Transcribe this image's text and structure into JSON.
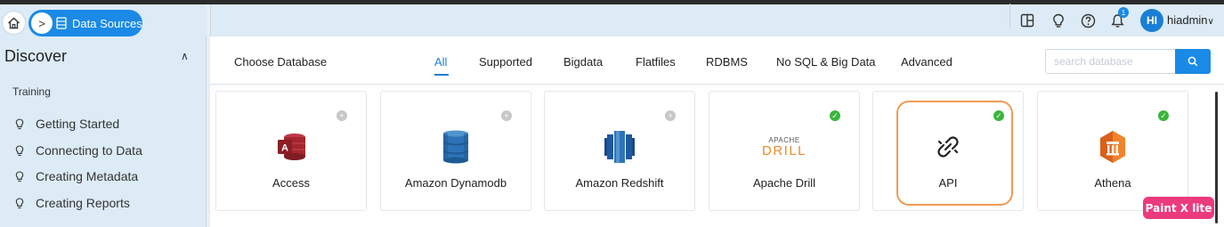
{
  "breadcrumb": {
    "current": "Data Sources",
    "separator": ">"
  },
  "header": {
    "notification_count": "1",
    "avatar_initials": "HI",
    "username": "hiadmin",
    "icons": [
      "layout-icon",
      "lightbulb-icon",
      "help-icon",
      "bell-icon"
    ]
  },
  "sidebar": {
    "title": "Discover",
    "section": "Training",
    "items": [
      {
        "label": "Getting Started"
      },
      {
        "label": "Connecting to Data"
      },
      {
        "label": "Creating Metadata"
      },
      {
        "label": "Creating Reports"
      }
    ]
  },
  "main": {
    "heading": "Choose Database",
    "tabs": [
      {
        "label": "All",
        "active": true
      },
      {
        "label": "Supported"
      },
      {
        "label": "Bigdata"
      },
      {
        "label": "Flatfiles"
      },
      {
        "label": "RDBMS"
      },
      {
        "label": "No SQL & Big Data"
      },
      {
        "label": "Advanced"
      }
    ],
    "search": {
      "placeholder": "search database",
      "value": ""
    },
    "cards": [
      {
        "label": "Access",
        "status": "add"
      },
      {
        "label": "Amazon Dynamodb",
        "status": "add"
      },
      {
        "label": "Amazon Redshift",
        "status": "add"
      },
      {
        "label": "Apache Drill",
        "status": "supported",
        "logo_text": [
          "APACHE",
          "DRILL"
        ]
      },
      {
        "label": "API",
        "status": "supported",
        "highlighted": true
      },
      {
        "label": "Athena",
        "status": "supported"
      }
    ]
  },
  "overlay_badge": "Paint X lite",
  "colors": {
    "accent": "#1a8ae6",
    "panel": "#dcebf5",
    "supported": "#3ab53a",
    "highlight": "#f19a53",
    "badge": "#ec3a7e"
  }
}
